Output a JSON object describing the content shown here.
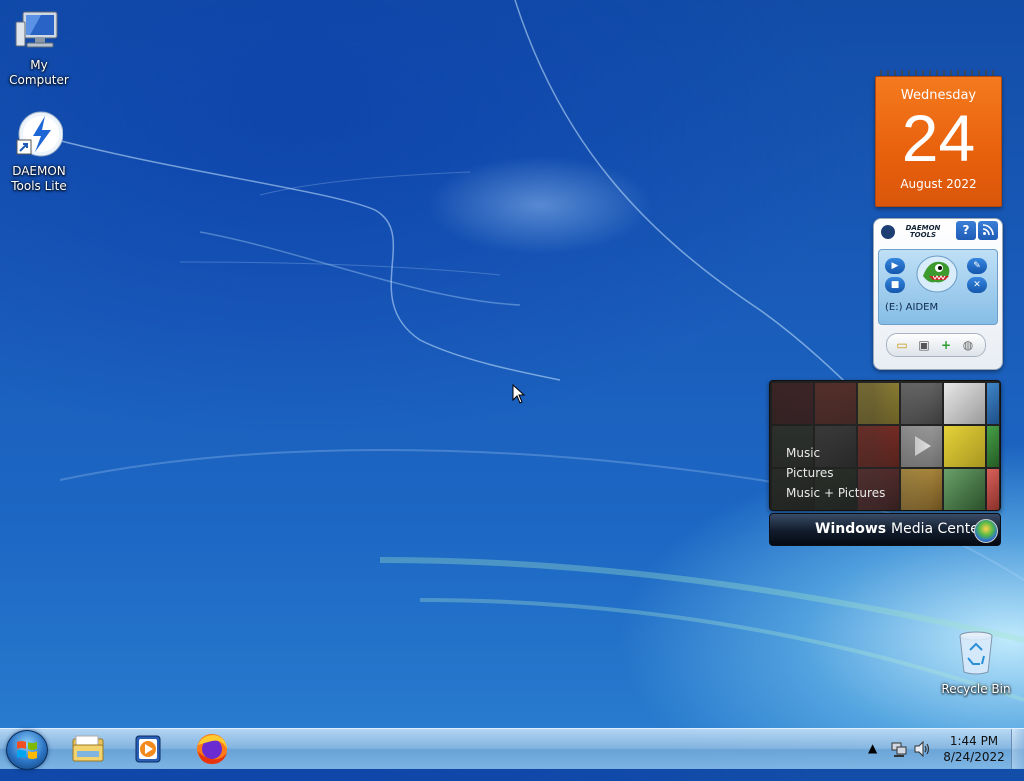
{
  "desktop": {
    "icons": [
      {
        "label": "My Computer",
        "icon": "computer-icon"
      },
      {
        "label": "DAEMON Tools Lite",
        "icon": "daemon-tools-icon"
      },
      {
        "label": "Recycle Bin",
        "icon": "recycle-bin-icon"
      }
    ]
  },
  "gadgets": {
    "calendar": {
      "weekday": "Wednesday",
      "day": "24",
      "month_year": "August 2022",
      "color": "#e8650f"
    },
    "daemon_tools": {
      "logo_line1": "DAEMON",
      "logo_line2": "TOOLS",
      "help_label": "?",
      "drive_label": "(E:) AIDEM"
    },
    "media_center": {
      "menu": [
        "Music",
        "Pictures",
        "Music + Pictures"
      ],
      "brand_bold": "Windows",
      "brand_rest": "Media Center"
    }
  },
  "taskbar": {
    "pinned": [
      {
        "name": "start-button",
        "icon": "windows-orb-icon"
      },
      {
        "name": "explorer-button",
        "icon": "folder-icon"
      },
      {
        "name": "media-player-button",
        "icon": "media-player-icon"
      },
      {
        "name": "firefox-button",
        "icon": "firefox-icon"
      }
    ],
    "clock": {
      "time": "1:44 PM",
      "date": "8/24/2022"
    }
  }
}
